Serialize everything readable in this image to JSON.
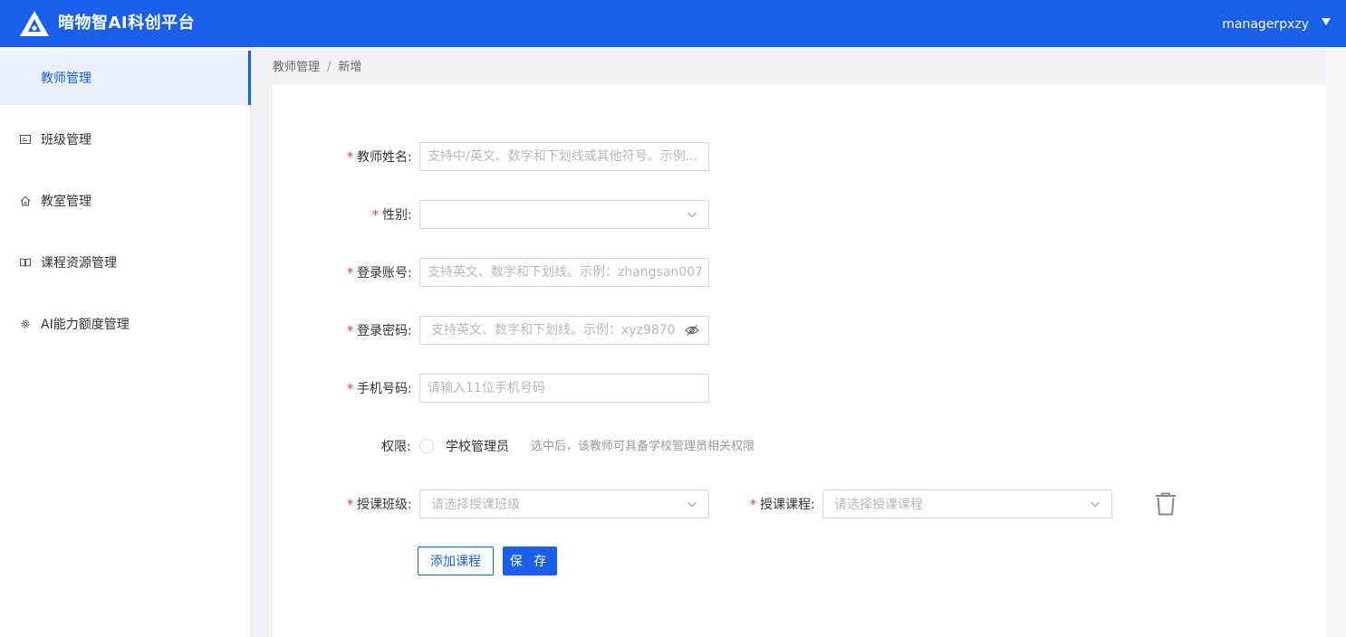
{
  "header": {
    "app_title": "暗物智AI科创平台",
    "username": "managerpxzy",
    "logo_icon": "triangle-a-logo",
    "brand_color": "#1a5fe8"
  },
  "sidebar": {
    "items": [
      {
        "label": "教师管理",
        "icon": "none",
        "active": true
      },
      {
        "label": "班级管理",
        "icon": "id-card-icon"
      },
      {
        "label": "教室管理",
        "icon": "home-icon"
      },
      {
        "label": "课程资源管理",
        "icon": "book-icon"
      },
      {
        "label": "AI能力额度管理",
        "icon": "gear-icon"
      }
    ]
  },
  "breadcrumb": {
    "parent": "教师管理",
    "separator": "/",
    "current": "新增"
  },
  "form": {
    "name": {
      "label": "教师姓名:",
      "required": "*",
      "placeholder": "支持中/英文、数字和下划线或其他符号。示例..."
    },
    "gender": {
      "label": "性别:",
      "required": "*",
      "value": ""
    },
    "account": {
      "label": "登录账号:",
      "required": "*",
      "placeholder": "支持英文、数字和下划线。示例：zhangsan007"
    },
    "password": {
      "label": "登录密码:",
      "required": "*",
      "placeholder": "支持英文、数字和下划线。示例：xyz9870"
    },
    "phone": {
      "label": "手机号码:",
      "required": "*",
      "placeholder": "请输入11位手机号码"
    },
    "permission": {
      "label": "权限:",
      "option": "学校管理员",
      "hint": "选中后，该教师可具备学校管理员相关权限",
      "checked": false
    },
    "class": {
      "label": "授课班级:",
      "required": "*",
      "placeholder": "请选择授课班级"
    },
    "course": {
      "label": "授课课程:",
      "required": "*",
      "placeholder": "请选择授课课程"
    }
  },
  "buttons": {
    "add_course": "添加课程",
    "save": "保 存"
  }
}
